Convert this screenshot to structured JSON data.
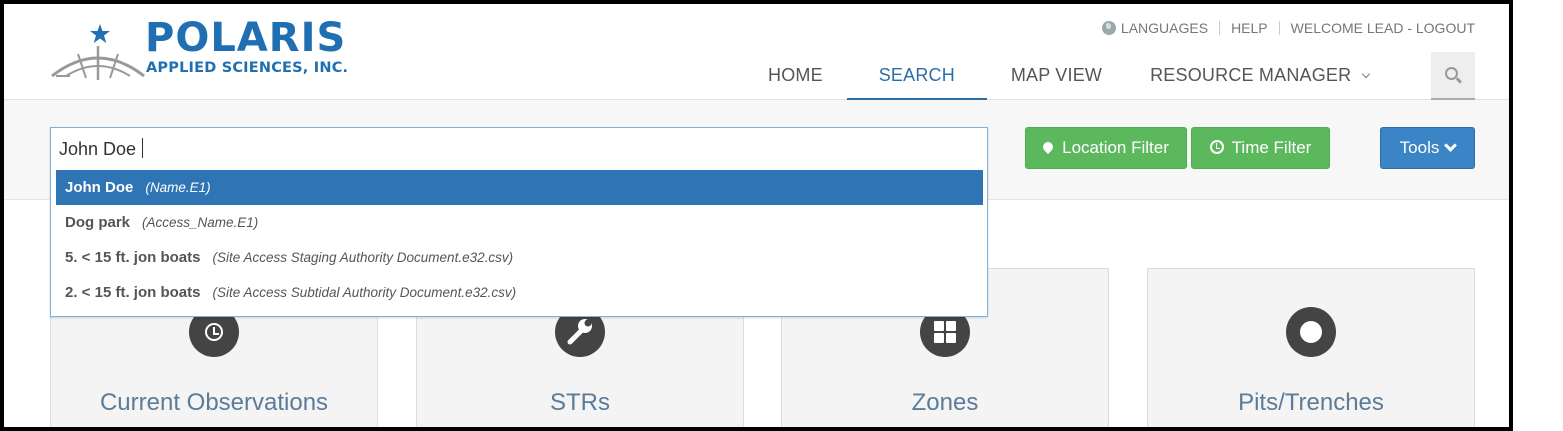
{
  "brand": {
    "name": "POLARIS",
    "subtitle": "APPLIED SCIENCES, INC.",
    "color": "#1f6fb2"
  },
  "util": {
    "languages": "LANGUAGES",
    "help": "HELP",
    "welcome": "WELCOME LEAD - LOGOUT"
  },
  "nav": {
    "home": "HOME",
    "search": "SEARCH",
    "map_view": "MAP VIEW",
    "resource_manager": "RESOURCE MANAGER",
    "active": "SEARCH"
  },
  "search": {
    "value": "John Doe",
    "suggestions": [
      {
        "main": "John Doe",
        "source": "(Name.E1)"
      },
      {
        "main": "Dog park",
        "source": "(Access_Name.E1)"
      },
      {
        "main": "5. < 15 ft. jon boats",
        "source": "(Site Access Staging Authority Document.e32.csv)"
      },
      {
        "main": "2. < 15 ft. jon boats",
        "source": "(Site Access Subtidal Authority Document.e32.csv)"
      }
    ],
    "selected_index": 0
  },
  "filters": {
    "location": "Location Filter",
    "time": "Time Filter",
    "tools": "Tools"
  },
  "cards": [
    {
      "title": "Current Observations",
      "icon": "clock-icon"
    },
    {
      "title": "STRs",
      "icon": "wrench-icon"
    },
    {
      "title": "Zones",
      "icon": "grid-icon"
    },
    {
      "title": "Pits/Trenches",
      "icon": "circle-icon"
    }
  ],
  "colors": {
    "accent": "#2f74b4",
    "green": "#5cb85c",
    "blue": "#3b84c6"
  }
}
